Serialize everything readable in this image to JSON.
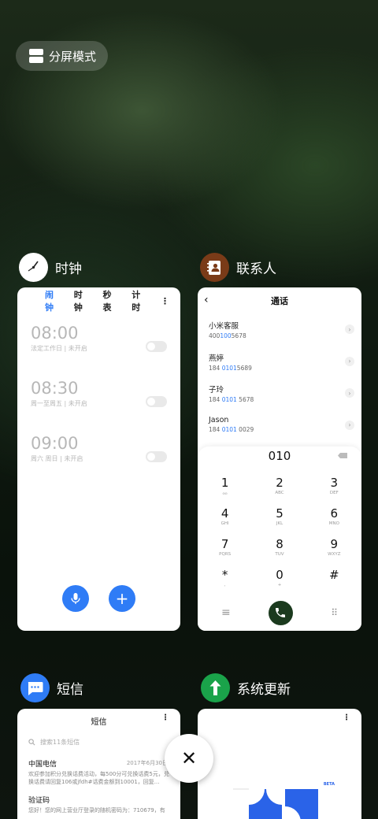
{
  "split_screen": {
    "label": "分屏模式"
  },
  "apps": {
    "clock": {
      "title": "时钟",
      "tabs": [
        "闹钟",
        "时钟",
        "秒表",
        "计时"
      ],
      "more": "⋮",
      "alarms": [
        {
          "time": "08:00",
          "sub": "法定工作日 | 未开启"
        },
        {
          "time": "08:30",
          "sub": "周一至周五 | 未开启"
        },
        {
          "time": "09:00",
          "sub": "周六 周日 | 未开启"
        }
      ],
      "voice_icon": "mic-icon",
      "add_label": "+"
    },
    "contacts": {
      "title": "联系人",
      "header": "通话",
      "back": "‹",
      "list": [
        {
          "name": "小米客服",
          "pre": "400",
          "hi": "100",
          "post": "5678"
        },
        {
          "name": "燕婷",
          "pre": "184 ",
          "hi": "0101",
          "post": "5689"
        },
        {
          "name": "子玲",
          "pre": "184 ",
          "hi": "0101",
          "post": " 5678"
        },
        {
          "name": "Jason",
          "pre": "184 ",
          "hi": "0101",
          "post": " 0029"
        }
      ],
      "dial_number": "010",
      "keys": [
        {
          "d": "1",
          "l": "ဓဓ"
        },
        {
          "d": "2",
          "l": "ABC"
        },
        {
          "d": "3",
          "l": "DEF"
        },
        {
          "d": "4",
          "l": "GHI"
        },
        {
          "d": "5",
          "l": "JKL"
        },
        {
          "d": "6",
          "l": "MNO"
        },
        {
          "d": "7",
          "l": "PQRS"
        },
        {
          "d": "8",
          "l": "TUV"
        },
        {
          "d": "9",
          "l": "WXYZ"
        },
        {
          "d": "*",
          "l": ","
        },
        {
          "d": "0",
          "l": "+"
        },
        {
          "d": "#",
          "l": ""
        }
      ],
      "menu_glyph": "≡",
      "keypad_glyph": "⠿"
    },
    "messages": {
      "title": "短信",
      "header": "短信",
      "more": "⋮",
      "search_placeholder": "搜索11条短信",
      "items": [
        {
          "sender": "中国电信",
          "date": "2017年6月30日",
          "body": "欢迎参加积分兑换话费活动，每500分可兑换话费5元，兑换话费请回复106或jfdh#话费金额到10001，回复..."
        },
        {
          "sender": "验证码",
          "date": "",
          "body": "您好！您的网上营业厅登录的随机密码为：710679，有"
        }
      ]
    },
    "updater": {
      "title": "系统更新",
      "more": "⋮",
      "badge": "BETA"
    }
  },
  "close": {
    "label": "✕"
  }
}
